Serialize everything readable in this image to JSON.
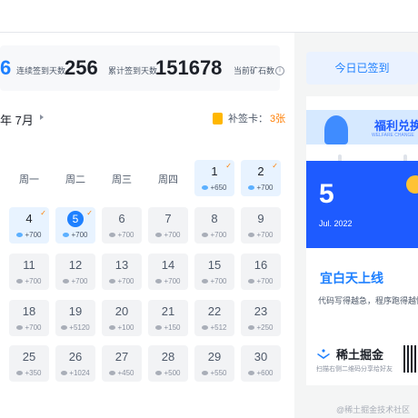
{
  "stats": {
    "streak_tail": "6",
    "streak_label": "连续签到天数",
    "total_days": "256",
    "total_label": "累计签到天数",
    "ore": "151678",
    "ore_label": "当前矿石数"
  },
  "calendar": {
    "month_label": "年 7月",
    "makeup_label": "补签卡：",
    "makeup_count": "3张",
    "weekdays": [
      "周一",
      "周二",
      "周三",
      "周四",
      "周五",
      "周六"
    ],
    "days": [
      {
        "d": "1",
        "p": "+650",
        "signed": true,
        "tick": true
      },
      {
        "d": "2",
        "p": "+700",
        "signed": true,
        "tick": true
      },
      {
        "d": "4",
        "p": "+700",
        "signed": true,
        "tick": true
      },
      {
        "d": "5",
        "p": "+700",
        "signed": true,
        "tick": true,
        "today": true
      },
      {
        "d": "6",
        "p": "+700"
      },
      {
        "d": "7",
        "p": "+700"
      },
      {
        "d": "8",
        "p": "+700"
      },
      {
        "d": "9",
        "p": "+700"
      },
      {
        "d": "11",
        "p": "+700"
      },
      {
        "d": "12",
        "p": "+700"
      },
      {
        "d": "13",
        "p": "+700"
      },
      {
        "d": "14",
        "p": "+700"
      },
      {
        "d": "15",
        "p": "+700"
      },
      {
        "d": "16",
        "p": "+700"
      },
      {
        "d": "18",
        "p": "+700"
      },
      {
        "d": "19",
        "p": "+5120"
      },
      {
        "d": "20",
        "p": "+100"
      },
      {
        "d": "21",
        "p": "+150"
      },
      {
        "d": "22",
        "p": "+512"
      },
      {
        "d": "23",
        "p": "+250"
      },
      {
        "d": "25",
        "p": "+350"
      },
      {
        "d": "26",
        "p": "+1024"
      },
      {
        "d": "27",
        "p": "+450"
      },
      {
        "d": "28",
        "p": "+500"
      },
      {
        "d": "29",
        "p": "+550"
      },
      {
        "d": "30",
        "p": "+600"
      }
    ]
  },
  "side": {
    "checkin_button": "今日已签到",
    "welfare_title": "福利兑换",
    "welfare_sub": "WELFARE CHANGE",
    "card_day": "5",
    "card_date": "Jul. 2022",
    "promo_title": "宜白天上线",
    "promo_desc": "代码写得越急，程序跑得越慢",
    "logo_text": "稀土掘金",
    "logo_sub": "扫描右侧二维码分享给好友",
    "watermark": "@稀土掘金技术社区"
  },
  "colors": {
    "accent": "#1e80ff",
    "orange": "#ff7d00"
  }
}
